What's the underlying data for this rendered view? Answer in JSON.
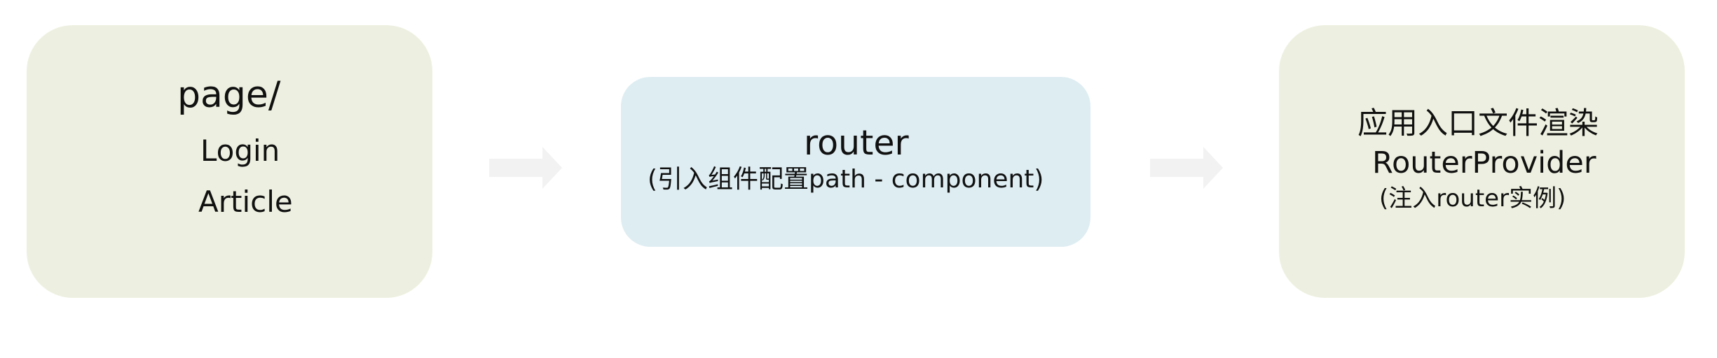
{
  "colors": {
    "pages_box": "#edf0e0",
    "router_box": "#deedf2",
    "app_box": "#edf0e0",
    "arrow": "#f2f2f2",
    "text": "#111111"
  },
  "pages": {
    "title": "page/",
    "items": [
      "Login",
      "Article"
    ]
  },
  "router": {
    "title": "router",
    "subtitle": "(引入组件配置path - component)"
  },
  "app": {
    "line1": "应用入口文件渲染",
    "line2": "RouterProvider",
    "line3": "(注入router实例)"
  },
  "arrows": [
    {
      "icon": "right-arrow-icon",
      "from": "pages",
      "to": "router"
    },
    {
      "icon": "right-arrow-icon",
      "from": "router",
      "to": "app"
    }
  ]
}
